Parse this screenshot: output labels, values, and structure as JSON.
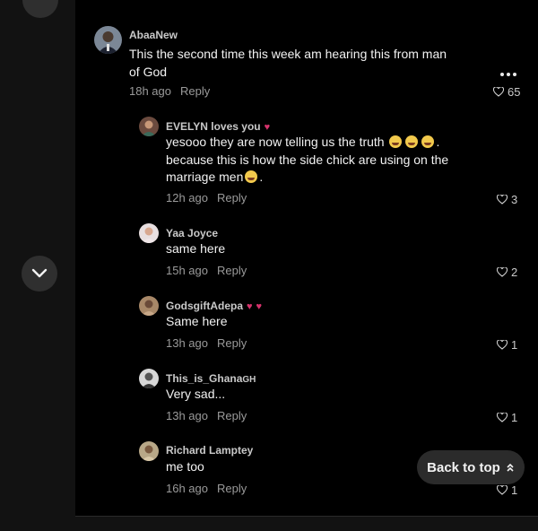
{
  "comments": [
    {
      "username": "AbaaNew",
      "text_line1": "This the second time this week am hearing this from man",
      "text_line2": "of God",
      "time": "18h ago",
      "reply_label": "Reply",
      "likes": "65"
    },
    {
      "username": "EVELYN loves you",
      "text_line1": "yesooo they are now telling us the truth",
      "text_line1_end": ".",
      "text_line2": "because this is how the side chick are using on the",
      "text_line3": "marriage men",
      "text_line3_end": ".",
      "time": "12h ago",
      "reply_label": "Reply",
      "likes": "3"
    },
    {
      "username": "Yaa Joyce",
      "text_line1": "same here",
      "time": "15h ago",
      "reply_label": "Reply",
      "likes": "2"
    },
    {
      "username": "GodsgiftAdepa",
      "text_line1": "Same here",
      "time": "13h ago",
      "reply_label": "Reply",
      "likes": "1"
    },
    {
      "username": "This_is_Ghana",
      "username_suffix": "GH",
      "text_line1": "Very sad...",
      "time": "13h ago",
      "reply_label": "Reply",
      "likes": "1"
    },
    {
      "username": "Richard Lamptey",
      "text_line1": "me too",
      "time": "16h ago",
      "reply_label": "Reply",
      "likes": "1"
    }
  ],
  "back_to_top": {
    "label": "Back to top"
  },
  "icons": {
    "heart": "heart-outline-icon",
    "more": "more-horizontal-icon",
    "chevron_down": "chevron-down-icon",
    "back_to_top": "double-chevron-up-icon"
  },
  "colors": {
    "background": "#000000",
    "side_background": "#121212",
    "accent_heart": "#d6336c",
    "muted_text": "#9a9a9a"
  }
}
